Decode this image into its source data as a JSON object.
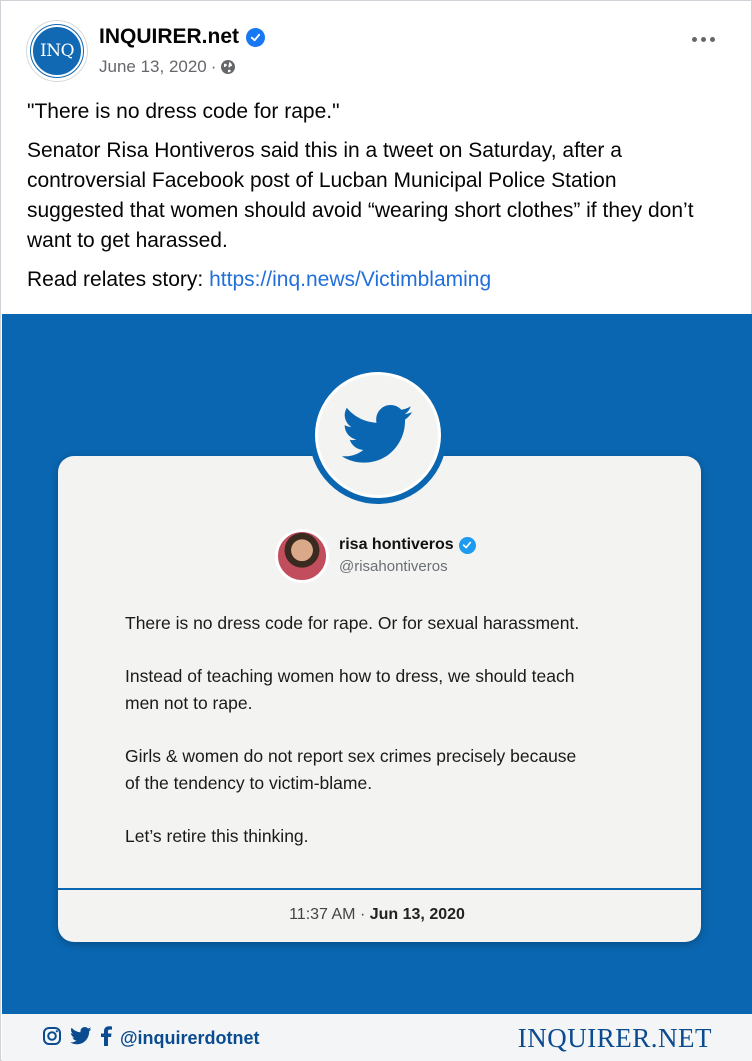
{
  "post": {
    "page_name": "INQUIRER.net",
    "avatar_text": "INQ",
    "date": "June 13, 2020",
    "separator": "·",
    "caption": {
      "quote": "\"There is no dress code for rape.\"",
      "body": "Senator Risa Hontiveros said this in a tweet on Saturday, after a controversial Facebook post of Lucban Municipal Police Station suggested that women should avoid “wearing short clothes” if they don’t want to get harassed.",
      "read_prefix": "Read relates story: ",
      "link": "https://inq.news/Victimblaming"
    }
  },
  "image": {
    "tweet": {
      "name": "risa hontiveros",
      "handle": "@risahontiveros",
      "lines": [
        "There is no dress code for rape. Or for sexual harassment.",
        "Instead of teaching women how to dress, we should teach men not to rape.",
        "Girls & women do not report sex crimes precisely because of the tendency to victim-blame.",
        "Let’s retire this thinking."
      ],
      "time": "11:37 AM · ",
      "date": "Jun 13, 2020"
    },
    "footer": {
      "handle": "@inquirerdotnet",
      "brand": "INQUIRER.NET"
    }
  },
  "icons": {
    "verified": "verified-badge-icon",
    "globe": "globe-icon",
    "more": "more-options-icon",
    "twitter": "twitter-bird-icon",
    "instagram": "instagram-icon",
    "facebook": "facebook-icon"
  },
  "colors": {
    "brand_blue": "#0a66b0",
    "link_blue": "#216fdb",
    "facebook_verified": "#1877f2",
    "twitter_verified": "#1d9bf0"
  }
}
